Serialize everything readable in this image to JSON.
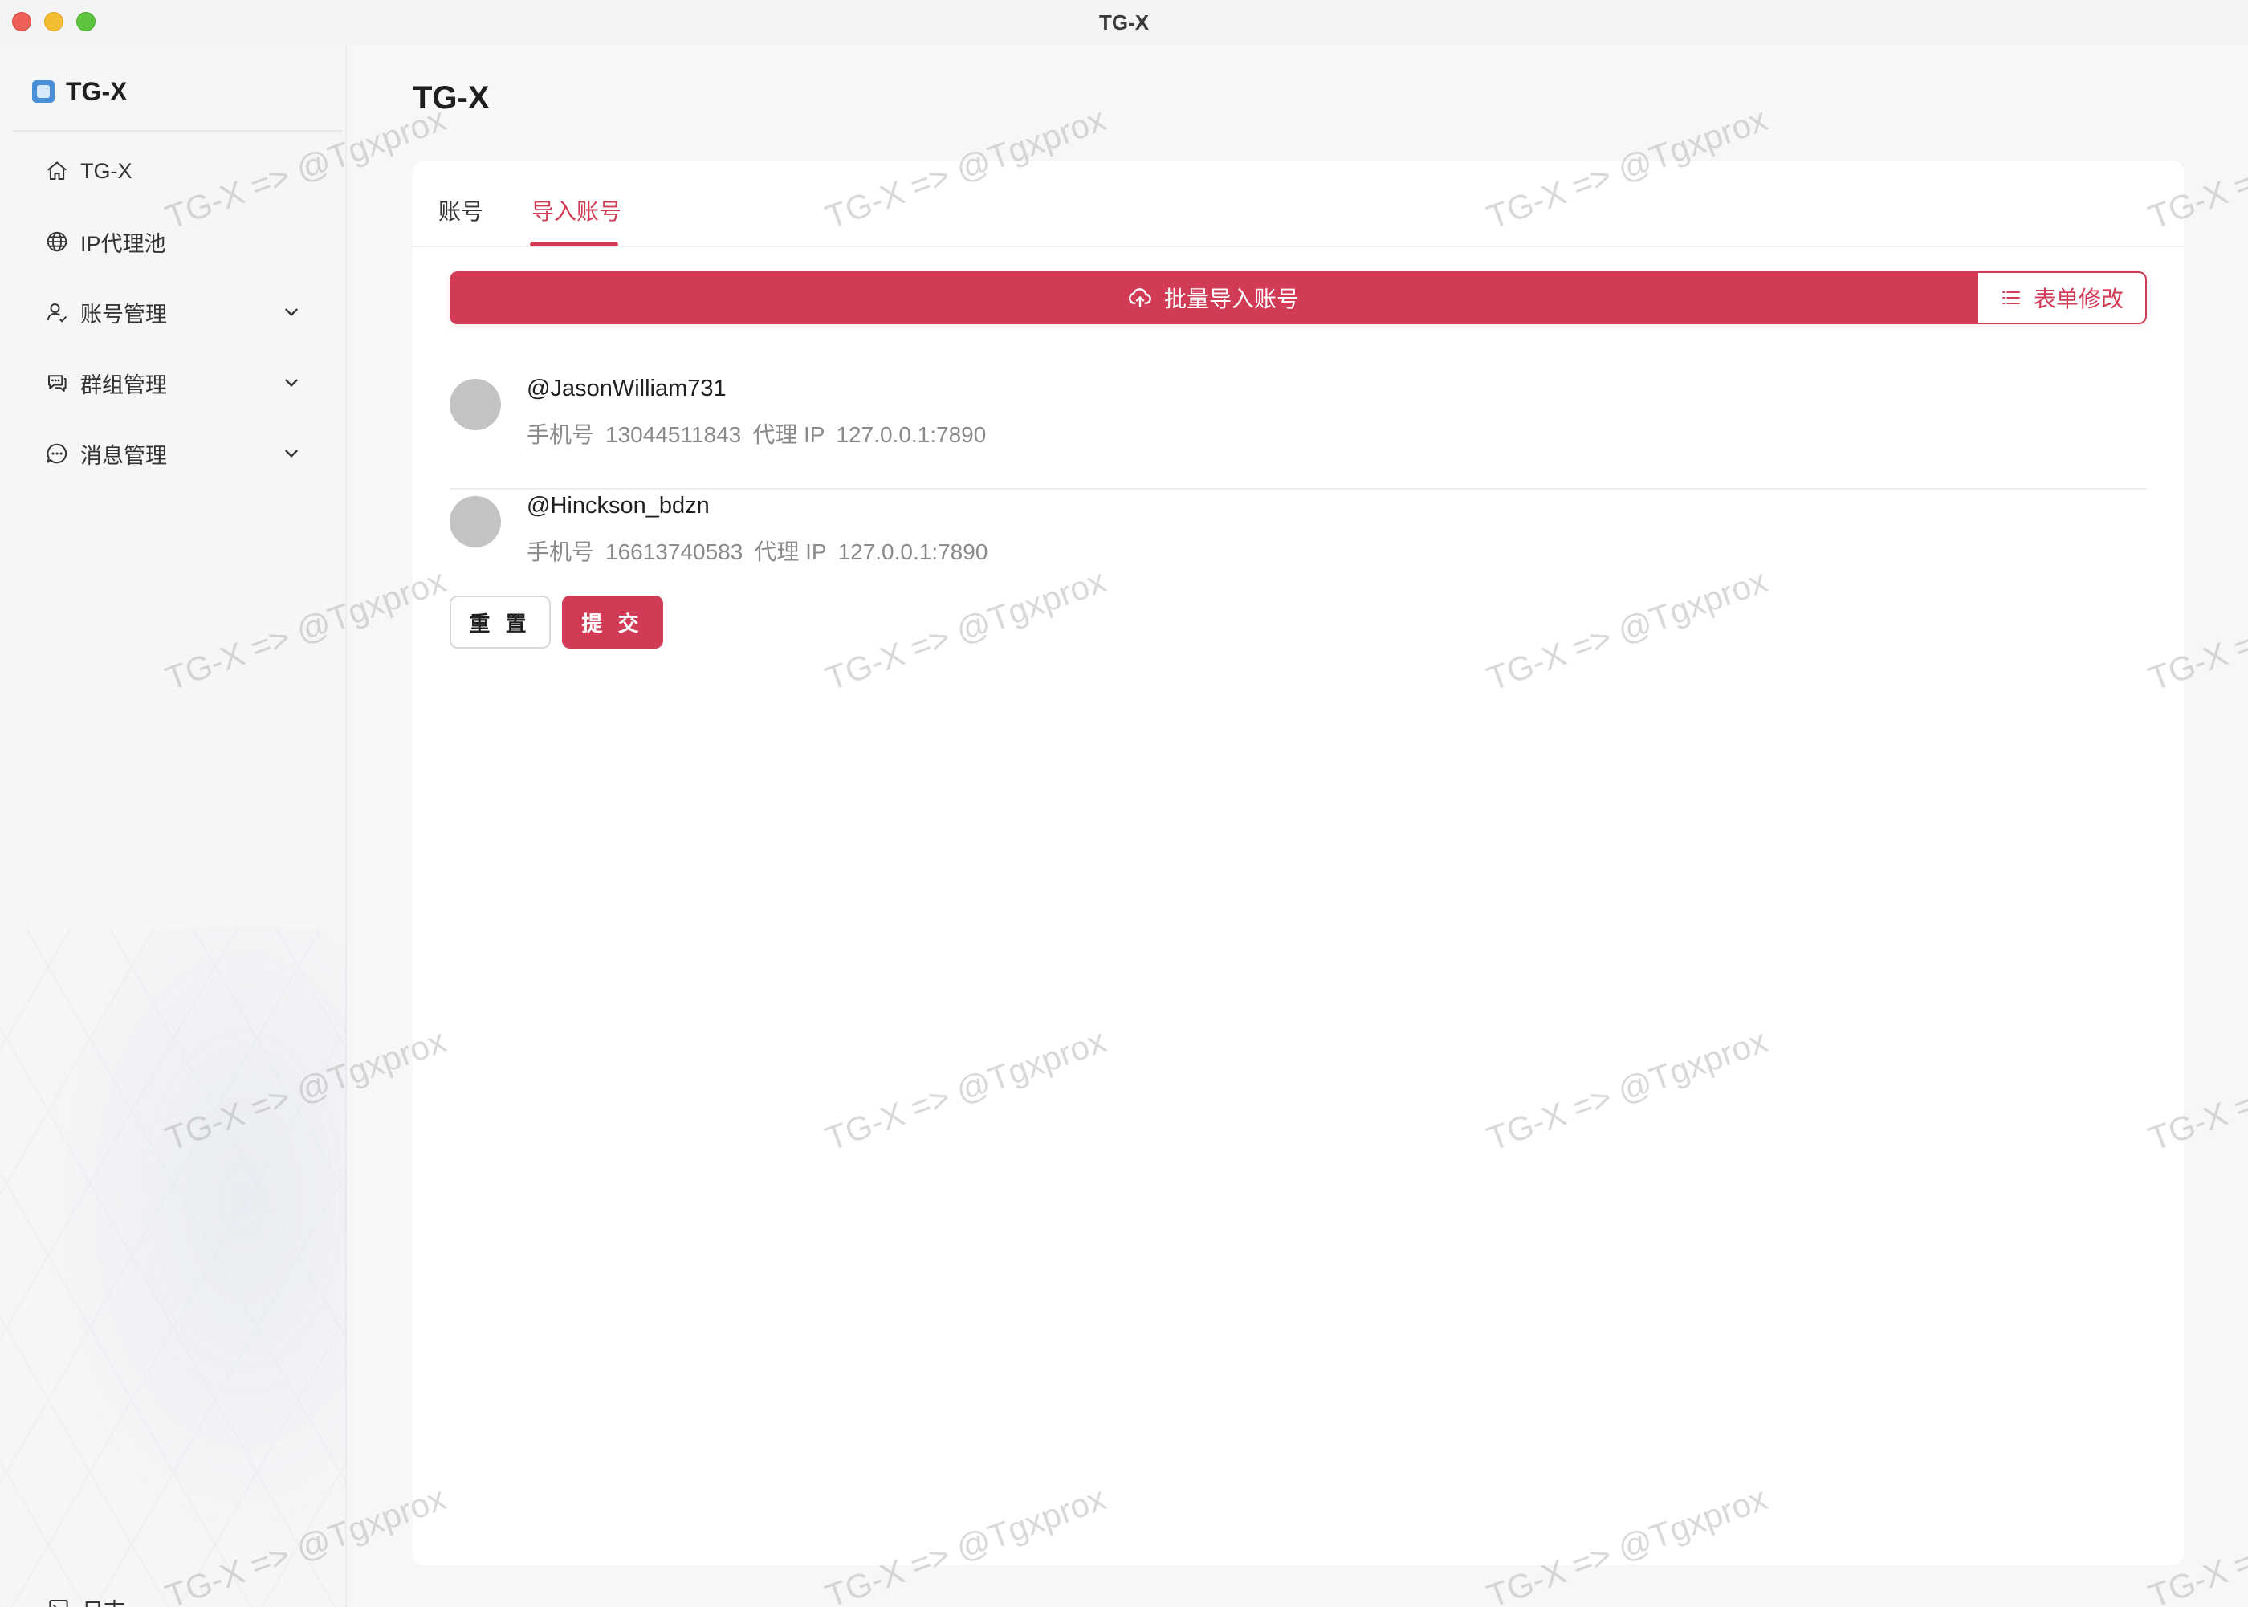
{
  "window": {
    "title": "TG-X"
  },
  "sidebar": {
    "brand": "TG-X",
    "items": [
      {
        "label": "TG-X",
        "icon": "home-icon"
      },
      {
        "label": "IP代理池",
        "icon": "globe-icon"
      },
      {
        "label": "账号管理",
        "icon": "user-icon",
        "expandable": true
      },
      {
        "label": "群组管理",
        "icon": "group-chat-icon",
        "expandable": true
      },
      {
        "label": "消息管理",
        "icon": "message-icon",
        "expandable": true
      }
    ],
    "log": {
      "label": "日志",
      "icon": "terminal-icon"
    }
  },
  "main": {
    "title": "TG-X",
    "tabs": [
      {
        "label": "账号",
        "active": false
      },
      {
        "label": "导入账号",
        "active": true
      }
    ],
    "actions": {
      "import_label": "批量导入账号",
      "form_label": "表单修改"
    },
    "accounts": [
      {
        "username": "@JasonWilliam731",
        "phone_label": "手机号",
        "phone": "13044511843",
        "proxy_label": "代理 IP",
        "proxy": "127.0.0.1:7890"
      },
      {
        "username": "@Hinckson_bdzn",
        "phone_label": "手机号",
        "phone": "16613740583",
        "proxy_label": "代理 IP",
        "proxy": "127.0.0.1:7890"
      }
    ],
    "buttons": {
      "reset": "重 置",
      "submit": "提 交"
    }
  },
  "watermark": "TG-X => @Tgxprox",
  "colors": {
    "accent": "#d13b55",
    "avatar": "#c3c3c3"
  }
}
